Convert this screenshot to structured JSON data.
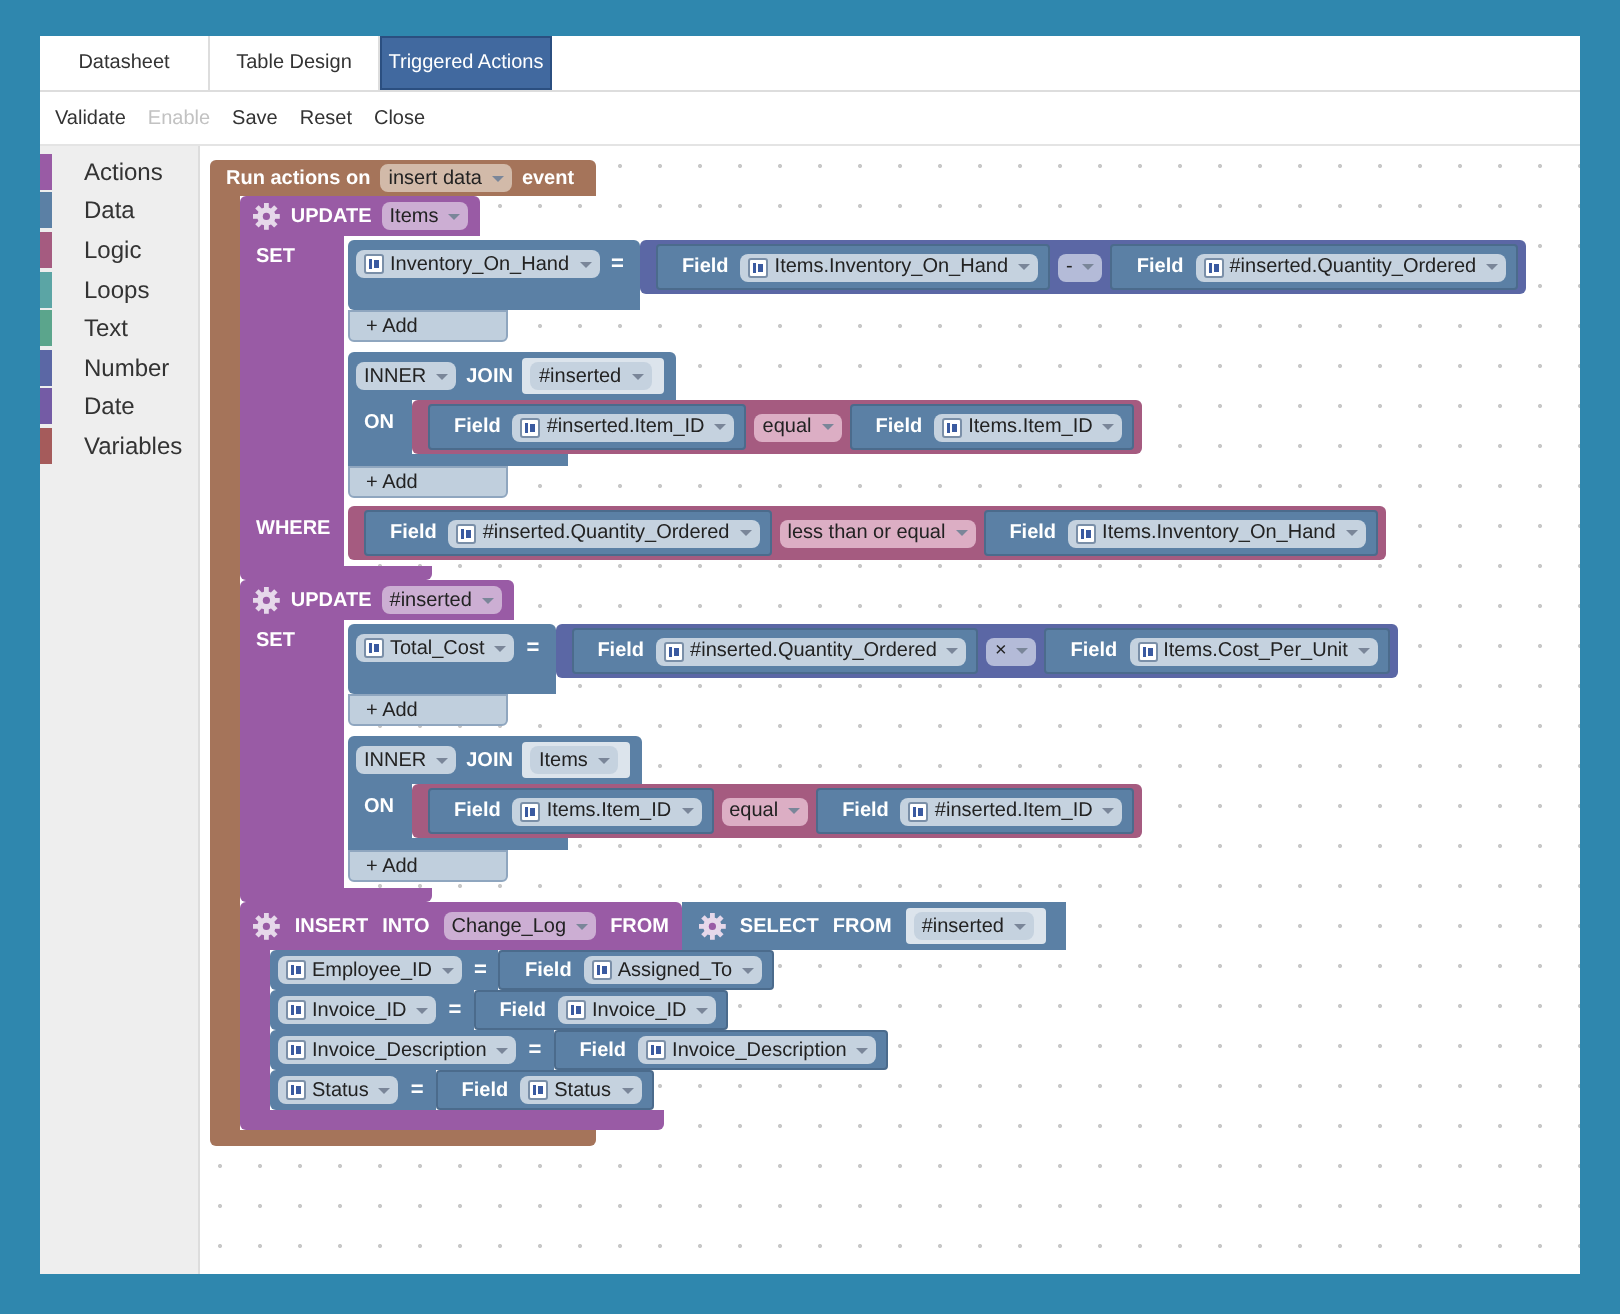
{
  "tabs": [
    {
      "label": "Datasheet",
      "selected": false
    },
    {
      "label": "Table Design",
      "selected": false
    },
    {
      "label": "Triggered Actions",
      "selected": true
    }
  ],
  "toolbar": [
    {
      "label": "Validate",
      "disabled": false
    },
    {
      "label": "Enable",
      "disabled": true
    },
    {
      "label": "Save",
      "disabled": false
    },
    {
      "label": "Reset",
      "disabled": false
    },
    {
      "label": "Close",
      "disabled": false
    }
  ],
  "categories": [
    {
      "label": "Actions",
      "color": "#995ba5"
    },
    {
      "label": "Data",
      "color": "#5b80a5"
    },
    {
      "label": "Logic",
      "color": "#a55b80"
    },
    {
      "label": "Loops",
      "color": "#5ba5a5"
    },
    {
      "label": "Text",
      "color": "#5ba58c"
    },
    {
      "label": "Number",
      "color": "#5b67a5"
    },
    {
      "label": "Date",
      "color": "#745ba5"
    },
    {
      "label": "Variables",
      "color": "#a55b5b"
    }
  ],
  "event_block": {
    "prefix": "Run actions on",
    "event": "insert data",
    "suffix": "event",
    "statements": [
      {
        "kind": "update",
        "keyword": "UPDATE",
        "table": "Items",
        "set_label": "SET",
        "assignments": [
          {
            "column": "Inventory_On_Hand",
            "operator": "=",
            "value": {
              "kind": "arithmetic",
              "left": {
                "kind": "field",
                "label": "Field",
                "value": "Items.Inventory_On_Hand"
              },
              "operator": "-",
              "right": {
                "kind": "field",
                "label": "Field",
                "value": "#inserted.Quantity_Ordered"
              }
            }
          }
        ],
        "add_button": "+ Add",
        "join": {
          "type": "INNER",
          "keyword": "JOIN",
          "table": "#inserted",
          "on_label": "ON",
          "condition": {
            "kind": "compare",
            "left": {
              "kind": "field",
              "label": "Field",
              "value": "#inserted.Item_ID"
            },
            "operator": "equal",
            "right": {
              "kind": "field",
              "label": "Field",
              "value": "Items.Item_ID"
            }
          },
          "add_button": "+ Add"
        },
        "where": {
          "label": "WHERE",
          "condition": {
            "kind": "compare",
            "left": {
              "kind": "field",
              "label": "Field",
              "value": "#inserted.Quantity_Ordered"
            },
            "operator": "less than or equal",
            "right": {
              "kind": "field",
              "label": "Field",
              "value": "Items.Inventory_On_Hand"
            }
          }
        }
      },
      {
        "kind": "update",
        "keyword": "UPDATE",
        "table": "#inserted",
        "set_label": "SET",
        "assignments": [
          {
            "column": "Total_Cost",
            "operator": "=",
            "value": {
              "kind": "arithmetic",
              "left": {
                "kind": "field",
                "label": "Field",
                "value": "#inserted.Quantity_Ordered"
              },
              "operator": "×",
              "right": {
                "kind": "field",
                "label": "Field",
                "value": "Items.Cost_Per_Unit"
              }
            }
          }
        ],
        "add_button": "+ Add",
        "join": {
          "type": "INNER",
          "keyword": "JOIN",
          "table": "Items",
          "on_label": "ON",
          "condition": {
            "kind": "compare",
            "left": {
              "kind": "field",
              "label": "Field",
              "value": "Items.Item_ID"
            },
            "operator": "equal",
            "right": {
              "kind": "field",
              "label": "Field",
              "value": "#inserted.Item_ID"
            }
          },
          "add_button": "+ Add"
        }
      },
      {
        "kind": "insert",
        "keyword": "INSERT",
        "into": "INTO",
        "table": "Change_Log",
        "from": "FROM",
        "source": {
          "keyword": "SELECT",
          "from": "FROM",
          "table": "#inserted"
        },
        "mappings": [
          {
            "column": "Employee_ID",
            "operator": "=",
            "value": {
              "kind": "field",
              "label": "Field",
              "value": "Assigned_To"
            }
          },
          {
            "column": "Invoice_ID",
            "operator": "=",
            "value": {
              "kind": "field",
              "label": "Field",
              "value": "Invoice_ID"
            }
          },
          {
            "column": "Invoice_Description",
            "operator": "=",
            "value": {
              "kind": "field",
              "label": "Field",
              "value": "Invoice_Description"
            }
          },
          {
            "column": "Status",
            "operator": "=",
            "value": {
              "kind": "field",
              "label": "Field",
              "value": "Status"
            }
          }
        ]
      }
    ]
  }
}
